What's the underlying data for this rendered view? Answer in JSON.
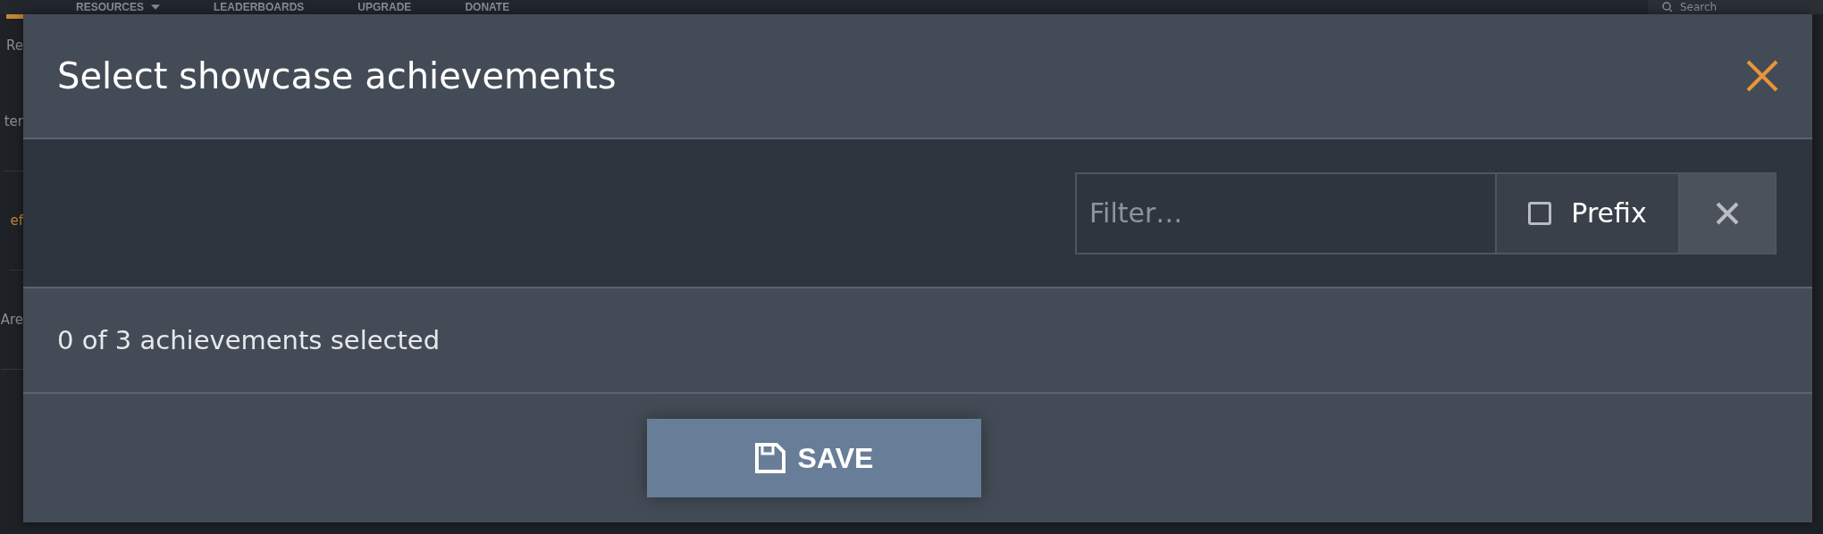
{
  "background_page": {
    "nav_items": [
      {
        "label": "RESOURCES",
        "dropdown": true
      },
      {
        "label": "LEADERBOARDS",
        "dropdown": false
      },
      {
        "label": "UPGRADE",
        "dropdown": false
      },
      {
        "label": "DONATE",
        "dropdown": false
      }
    ],
    "search": {
      "placeholder": "Search"
    },
    "side_texts": [
      {
        "text": "Re",
        "kind": "tab"
      },
      {
        "text": "ter",
        "kind": "plain"
      },
      {
        "text": "ef",
        "kind": "link"
      },
      {
        "text": "Are",
        "kind": "plain"
      }
    ]
  },
  "dialog": {
    "title": "Select showcase achievements",
    "filter": {
      "placeholder": "Filter…",
      "prefix_label": "Prefix",
      "prefix_checked": false
    },
    "count_text": "0 of 3 achievements selected",
    "save_button": "SAVE"
  }
}
